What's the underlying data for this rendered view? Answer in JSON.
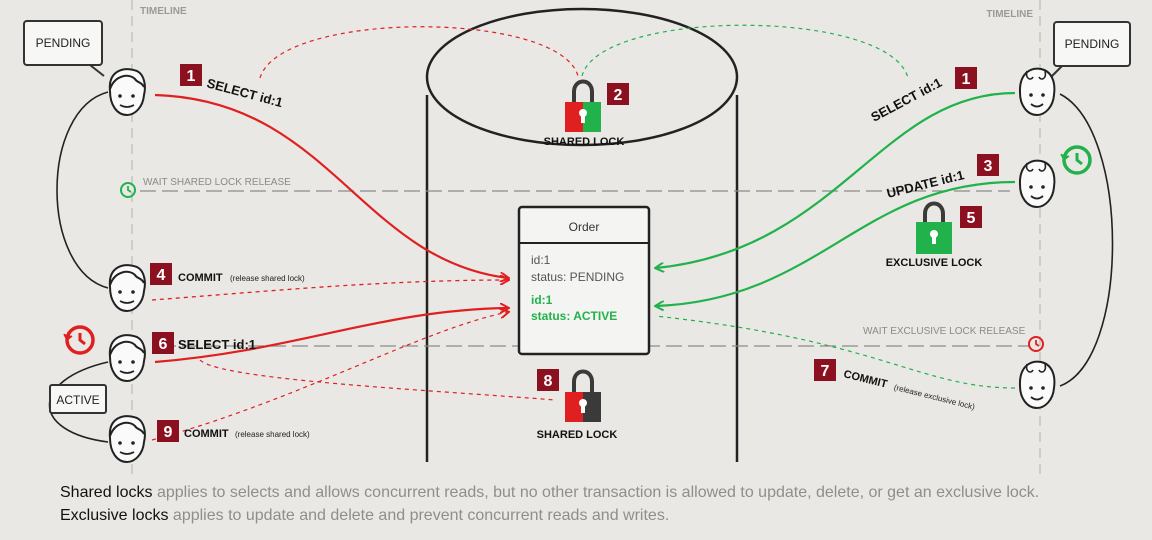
{
  "timeline_labels": {
    "left": "TIMELINE",
    "right": "TIMELINE"
  },
  "states": {
    "pending_left": "PENDING",
    "pending_right": "PENDING",
    "active": "ACTIVE"
  },
  "waits": {
    "shared": "WAIT SHARED LOCK RELEASE",
    "exclusive": "WAIT EXCLUSIVE LOCK RELEASE"
  },
  "steps": [
    {
      "num": "1",
      "text": "SELECT id:1",
      "note": ""
    },
    {
      "num": "1",
      "text": "SELECT id:1",
      "note": ""
    },
    {
      "num": "2",
      "text": "",
      "note": ""
    },
    {
      "num": "3",
      "text": "UPDATE id:1",
      "note": ""
    },
    {
      "num": "4",
      "text": "COMMIT",
      "note": "(release shared lock)"
    },
    {
      "num": "5",
      "text": "",
      "note": ""
    },
    {
      "num": "6",
      "text": "SELECT id:1",
      "note": ""
    },
    {
      "num": "7",
      "text": "COMMIT",
      "note": "(release exclusive lock)"
    },
    {
      "num": "8",
      "text": "",
      "note": ""
    },
    {
      "num": "9",
      "text": "COMMIT",
      "note": "(release shared lock)"
    }
  ],
  "locks": {
    "shared_top": "SHARED LOCK",
    "exclusive": "EXCLUSIVE LOCK",
    "shared_bottom": "SHARED LOCK"
  },
  "order": {
    "title": "Order",
    "line1": "id:1",
    "line2": "status: PENDING",
    "line3": "id:1",
    "line4": "status: ACTIVE"
  },
  "caption": {
    "line1_strong": "Shared locks",
    "line1_rest": " applies to selects and allows concurrent reads, but no other transaction is allowed to update, delete, or get an exclusive lock.",
    "line2_strong": "Exclusive locks",
    "line2_rest": " applies to update and delete and prevent concurrent reads and writes."
  },
  "colors": {
    "red": "#e02020",
    "green": "#22b24c",
    "badge": "#8b1020",
    "lock_gray": "#3a3a3a"
  }
}
